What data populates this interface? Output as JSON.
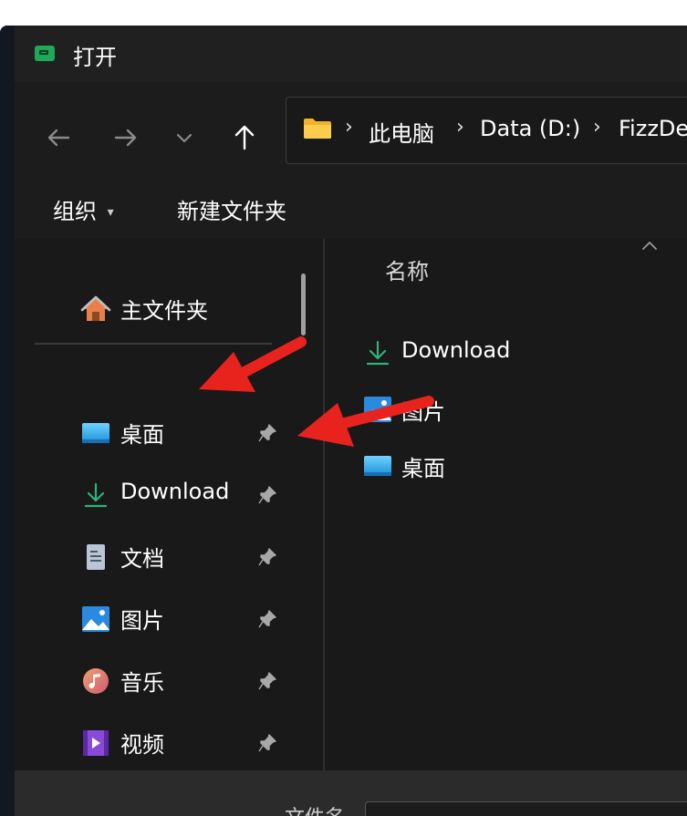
{
  "window": {
    "title": "打开"
  },
  "nav": {
    "back_icon": "arrow-left-icon",
    "forward_icon": "arrow-right-icon",
    "recent_icon": "chevron-down-icon",
    "up_icon": "arrow-up-icon"
  },
  "address": {
    "crumbs": [
      "此电脑",
      "Data (D:)",
      "FizzDe"
    ],
    "separator": "›"
  },
  "toolbar": {
    "organize_label": "组织",
    "organize_caret": "▾",
    "new_folder_label": "新建文件夹"
  },
  "sidebar": {
    "home": {
      "label": "主文件夹",
      "icon": "home-icon"
    },
    "items": [
      {
        "label": "桌面",
        "icon": "desktop-icon",
        "pinned": true
      },
      {
        "label": "Download",
        "icon": "download-icon",
        "pinned": true
      },
      {
        "label": "文档",
        "icon": "document-icon",
        "pinned": true
      },
      {
        "label": "图片",
        "icon": "pictures-icon",
        "pinned": true
      },
      {
        "label": "音乐",
        "icon": "music-icon",
        "pinned": true
      },
      {
        "label": "视频",
        "icon": "video-icon",
        "pinned": true
      }
    ]
  },
  "content": {
    "column_header": "名称",
    "rows": [
      {
        "label": "Download",
        "icon": "download-icon"
      },
      {
        "label": "图片",
        "icon": "pictures-icon"
      },
      {
        "label": "桌面",
        "icon": "desktop-icon"
      }
    ]
  },
  "footer": {
    "filename_label": "文件名"
  },
  "colors": {
    "background": "#1c1c1c",
    "pane": "#191919",
    "accent_green": "#1fa857",
    "download_green": "#2fb37a",
    "arrow_red": "#e8231e"
  }
}
